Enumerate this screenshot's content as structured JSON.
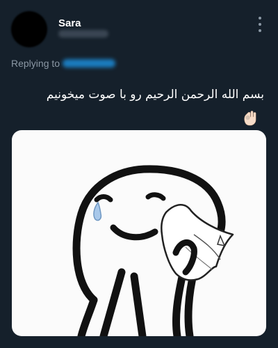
{
  "tweet": {
    "author": {
      "name": "Sara"
    },
    "replying_to_label": "Replying to",
    "text": "بسم الله الرحمن الرحیم رو با صوت میخونیم",
    "emoji_icon": "ok-hand-emoji-icon",
    "media_description_icon": "crying-stick-figure-meme-icon"
  },
  "colors": {
    "background": "#15202b",
    "text": "#ffffff",
    "secondary": "#8b98a5",
    "accent": "#1d9bf0"
  }
}
